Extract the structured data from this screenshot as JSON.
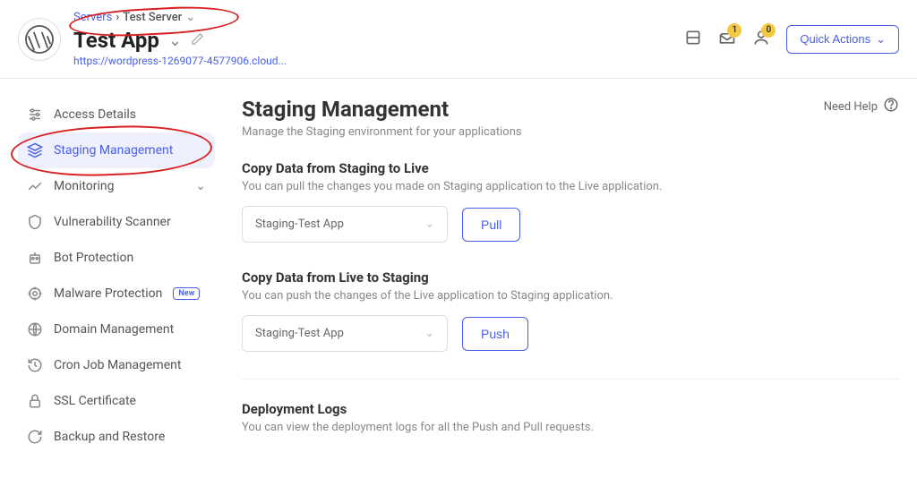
{
  "breadcrumb": {
    "link": "Servers",
    "server": "Test Server"
  },
  "app": {
    "name": "Test App",
    "url": "https://wordpress-1269077-4577906.cloud..."
  },
  "header": {
    "quick_actions": "Quick Actions",
    "badge_notif": "1",
    "badge_user": "0"
  },
  "sidebar": {
    "items": [
      {
        "label": "Access Details"
      },
      {
        "label": "Staging Management"
      },
      {
        "label": "Monitoring"
      },
      {
        "label": "Vulnerability Scanner"
      },
      {
        "label": "Bot Protection"
      },
      {
        "label": "Malware Protection",
        "new": "New"
      },
      {
        "label": "Domain Management"
      },
      {
        "label": "Cron Job Management"
      },
      {
        "label": "SSL Certificate"
      },
      {
        "label": "Backup and Restore"
      }
    ]
  },
  "content": {
    "title": "Staging Management",
    "subtitle": "Manage the Staging environment for your applications",
    "need_help": "Need Help",
    "pull": {
      "title": "Copy Data from Staging to Live",
      "desc": "You can pull the changes you made on Staging application to the Live application.",
      "selected": "Staging-Test App",
      "btn": "Pull"
    },
    "push": {
      "title": "Copy Data from Live to Staging",
      "desc": "You can push the changes of the Live application to Staging application.",
      "selected": "Staging-Test App",
      "btn": "Push"
    },
    "logs": {
      "title": "Deployment Logs",
      "desc": "You can view the deployment logs for all the Push and Pull requests."
    }
  }
}
